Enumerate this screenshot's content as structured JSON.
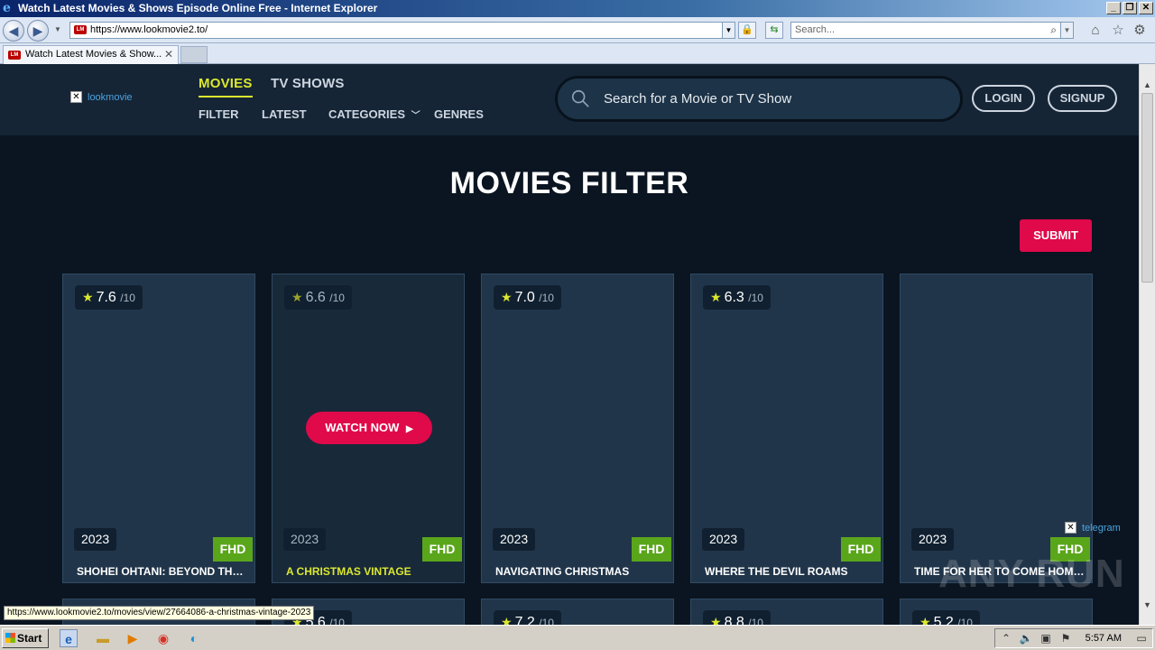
{
  "window": {
    "title": "Watch Latest Movies & Shows Episode Online Free - Internet Explorer",
    "address": "https://www.lookmovie2.to/",
    "search_placeholder": "Search...",
    "tab_title": "Watch Latest Movies & Show...",
    "favicon_text": "LM"
  },
  "site": {
    "logo_text": "lookmovie",
    "main_nav": [
      "MOVIES",
      "TV SHOWS"
    ],
    "sub_nav": [
      "FILTER",
      "LATEST",
      "CATEGORIES",
      "GENRES"
    ],
    "search_placeholder": "Search for a Movie or TV Show",
    "login": "LOGIN",
    "signup": "SIGNUP",
    "page_title": "MOVIES FILTER",
    "submit": "SUBMIT",
    "watch_now": "WATCH NOW",
    "rating_suffix": "/10",
    "telegram": "telegram",
    "watermark": "ANY RUN"
  },
  "movies": [
    {
      "rating": "7.6",
      "year": "2023",
      "quality": "FHD",
      "title": "SHOHEI OHTANI: BEYOND THE..."
    },
    {
      "rating": "6.6",
      "year": "2023",
      "quality": "FHD",
      "title": "A CHRISTMAS VINTAGE"
    },
    {
      "rating": "7.0",
      "year": "2023",
      "quality": "FHD",
      "title": "NAVIGATING CHRISTMAS"
    },
    {
      "rating": "6.3",
      "year": "2023",
      "quality": "FHD",
      "title": "WHERE THE DEVIL ROAMS"
    },
    {
      "rating": "",
      "year": "2023",
      "quality": "FHD",
      "title": "TIME FOR HER TO COME HOME..."
    }
  ],
  "movies_row2": [
    {
      "rating": "5.6"
    },
    {
      "rating": "7.2"
    },
    {
      "rating": "8.8"
    },
    {
      "rating": "5.2"
    }
  ],
  "status_url": "https://www.lookmovie2.to/movies/view/27664086-a-christmas-vintage-2023",
  "taskbar": {
    "start": "Start",
    "clock": "5:57 AM"
  }
}
